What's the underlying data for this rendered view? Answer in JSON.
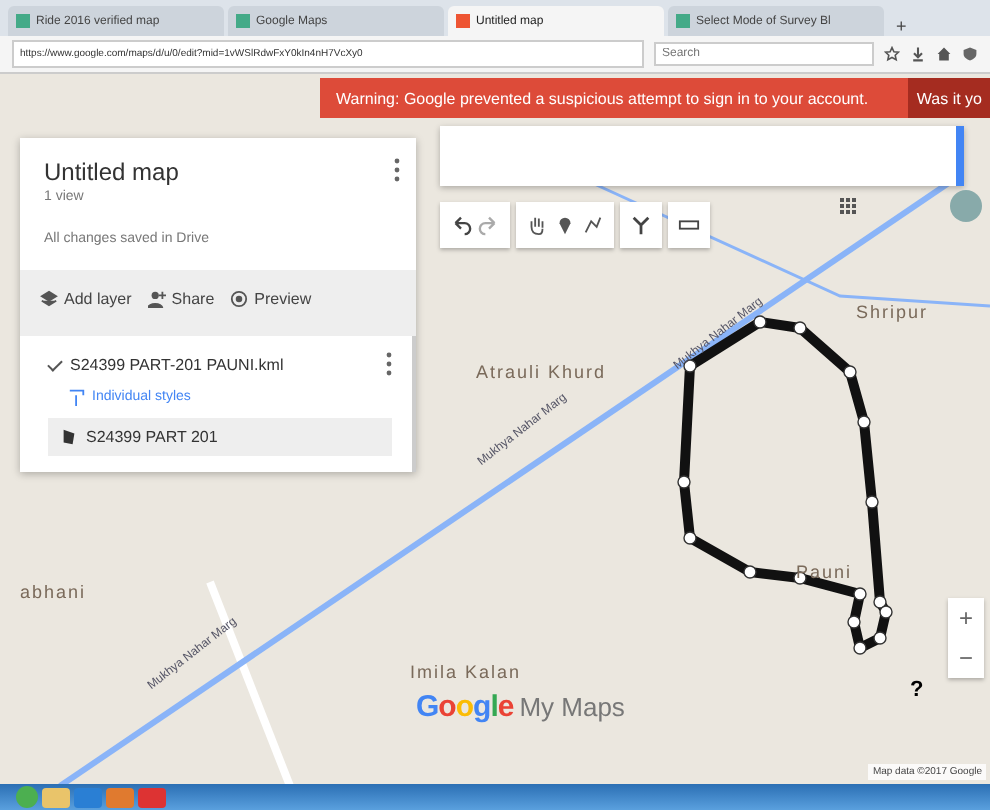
{
  "browser": {
    "tabs": [
      {
        "label": "Ride 2016 verified map",
        "selected": false
      },
      {
        "label": "Google Maps",
        "selected": false
      },
      {
        "label": "Untitled map",
        "selected": true
      },
      {
        "label": "Select Mode of Survey Bl",
        "selected": false
      }
    ],
    "new_tab": "+",
    "url": "https://www.google.com/maps/d/u/0/edit?mid=1vWSlRdwFxY0kIn4nH7VcXy0",
    "search": {
      "placeholder": "Search"
    }
  },
  "warning": {
    "message": "Warning: Google prevented a suspicious attempt to sign in to your account.",
    "action": "Was it yo"
  },
  "panel": {
    "title": "Untitled map",
    "views": "1 view",
    "saved": "All changes saved in Drive",
    "actions": [
      "Add layer",
      "Share",
      "Preview"
    ],
    "layer": {
      "name": "S24399 PART-201 PAUNI.kml",
      "checked": true,
      "style": "Individual styles",
      "features": [
        {
          "name": "S24399 PART 201",
          "selected": true
        }
      ]
    }
  },
  "map": {
    "labels": [
      {
        "text": "Atrauli Khurd",
        "kind": "place"
      },
      {
        "text": "Shripur",
        "kind": "place"
      },
      {
        "text": "Pauni",
        "kind": "place"
      },
      {
        "text": "abhani",
        "kind": "place"
      },
      {
        "text": "Imila Kalan",
        "kind": "place"
      },
      {
        "text": "Mukhya Nahar Marg",
        "kind": "road"
      },
      {
        "text": "Mukhya Nahar Marg",
        "kind": "road"
      },
      {
        "text": "Mukhya Nahar Marg",
        "kind": "road"
      }
    ],
    "logo": {
      "brand": "Google",
      "product": "My Maps"
    },
    "zoom": [
      "+",
      "−"
    ],
    "help": "?",
    "attribution": "Map data ©2017 Google"
  }
}
